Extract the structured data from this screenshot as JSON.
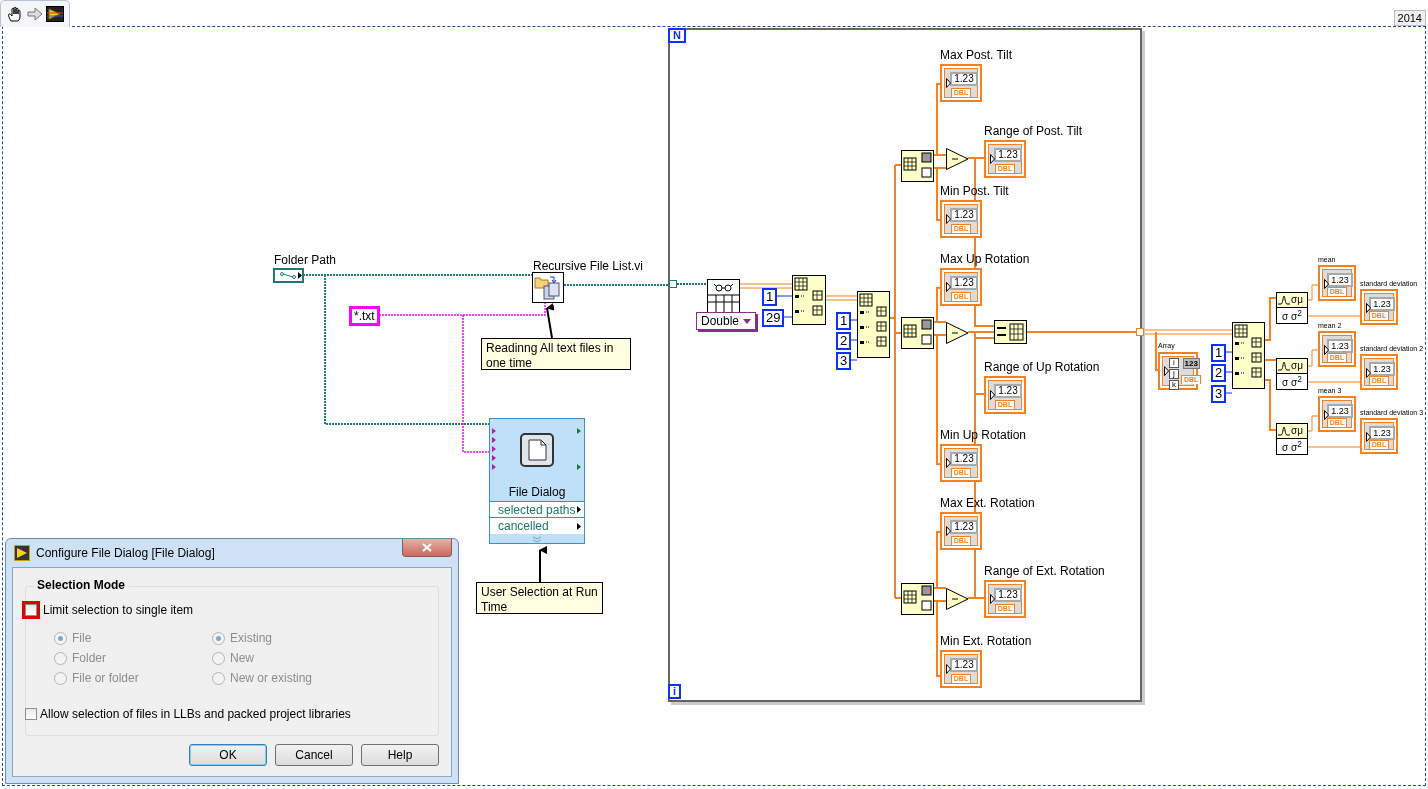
{
  "toolbar": {
    "version": "2014"
  },
  "folder_path": {
    "label": "Folder Path"
  },
  "subvi": {
    "label": "Recursive File List.vi"
  },
  "pattern": {
    "value": "*.txt"
  },
  "comments": [
    "Readinng All text files in one time",
    "User Selection at Run Time"
  ],
  "file_dialog": {
    "title": "File Dialog",
    "outputs": [
      "selected paths",
      "cancelled"
    ]
  },
  "loop": {
    "count_terminal": "N",
    "iteration_terminal": "i"
  },
  "read_spreadsheet": {
    "type": "Double"
  },
  "constants": [
    "1",
    "29",
    "1",
    "2",
    "3",
    "1",
    "2",
    "3"
  ],
  "loop_indicators": [
    {
      "label": "Max Post. Tilt",
      "value": "1.23",
      "type": "DBL"
    },
    {
      "label": "Range of Post. Tilt",
      "value": "1.23",
      "type": "DBL"
    },
    {
      "label": "Min Post. Tilt",
      "value": "1.23",
      "type": "DBL"
    },
    {
      "label": "Max Up Rotation",
      "value": "1.23",
      "type": "DBL"
    },
    {
      "label": "Range of Up Rotation",
      "value": "1.23",
      "type": "DBL"
    },
    {
      "label": "Min Up Rotation",
      "value": "1.23",
      "type": "DBL"
    },
    {
      "label": "Max Ext. Rotation",
      "value": "1.23",
      "type": "DBL"
    },
    {
      "label": "Range of Ext. Rotation",
      "value": "1.23",
      "type": "DBL"
    },
    {
      "label": "Min Ext. Rotation",
      "value": "1.23",
      "type": "DBL"
    }
  ],
  "array_indicator": {
    "label": "Array",
    "indices": [
      "i",
      "j",
      "k"
    ],
    "value": "123",
    "type": "DBL"
  },
  "statistics": [
    {
      "top": "σμ",
      "bottom": "σ σ$^{2}$"
    },
    {
      "top": "σμ",
      "bottom": "σ σ$^{2}$"
    },
    {
      "top": "σμ",
      "bottom": "σ σ$^{2}$"
    }
  ],
  "stat_indicators": [
    {
      "label": "mean",
      "value": "1.23",
      "type": "DBL"
    },
    {
      "label": "standard deviation",
      "value": "1.23",
      "type": "DBL"
    },
    {
      "label": "mean 2",
      "value": "1.23",
      "type": "DBL"
    },
    {
      "label": "standard deviation 2",
      "value": "1.23",
      "type": "DBL"
    },
    {
      "label": "mean 3",
      "value": "1.23",
      "type": "DBL"
    },
    {
      "label": "standard deviation 3",
      "value": "1.23",
      "type": "DBL"
    }
  ],
  "dialog": {
    "title": "Configure File Dialog [File Dialog]",
    "group": "Selection Mode",
    "limit_single": {
      "label": "Limit selection to single item",
      "checked": false,
      "highlighted": true
    },
    "type_options": [
      {
        "label": "File",
        "selected": true,
        "disabled": true
      },
      {
        "label": "Folder",
        "selected": false,
        "disabled": true
      },
      {
        "label": "File or folder",
        "selected": false,
        "disabled": true
      }
    ],
    "existence_options": [
      {
        "label": "Existing",
        "selected": true,
        "disabled": true
      },
      {
        "label": "New",
        "selected": false,
        "disabled": true
      },
      {
        "label": "New or existing",
        "selected": false,
        "disabled": true
      }
    ],
    "allow_llb": {
      "label": "Allow selection of files in LLBs and packed project libraries",
      "checked": false
    },
    "buttons": [
      {
        "label": "OK",
        "default": true
      },
      {
        "label": "Cancel",
        "default": false
      },
      {
        "label": "Help",
        "default": false
      }
    ]
  }
}
